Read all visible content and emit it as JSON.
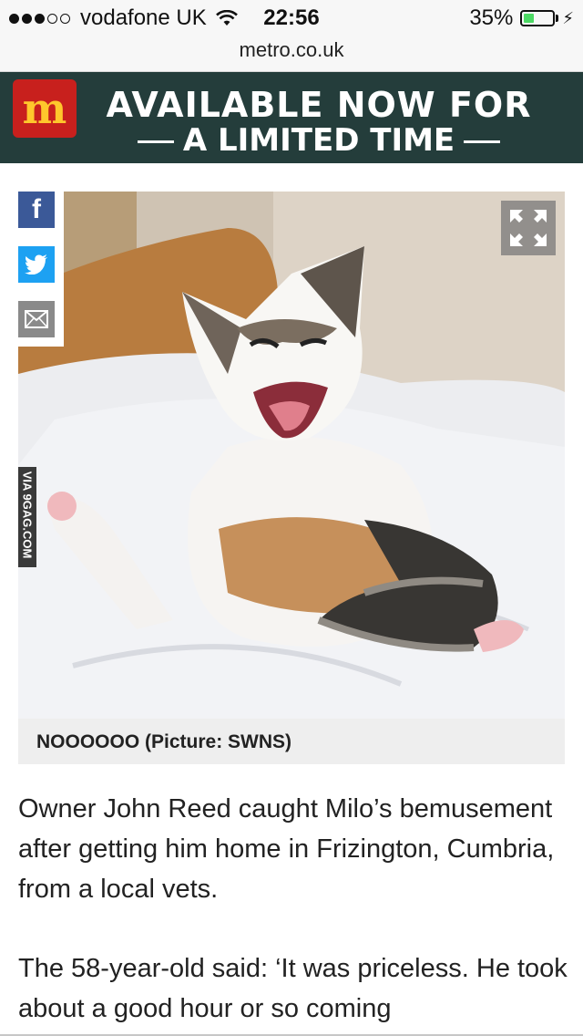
{
  "status_bar": {
    "carrier": "vodafone UK",
    "time": "22:56",
    "battery_percent": "35%",
    "battery_level": 0.35,
    "url": "metro.co.uk"
  },
  "ad": {
    "logo_text": "m",
    "line1": "AVAILABLE NOW FOR",
    "line2": "A LIMITED TIME"
  },
  "share": {
    "facebook": "f"
  },
  "image": {
    "watermark": "VIA 9GAG.COM",
    "caption": "NOOOOOO (Picture: SWNS)"
  },
  "article": {
    "paragraph1": "Owner John Reed caught Milo’s bemusement after getting him home in Frizington, Cumbria, from a local vets.",
    "paragraph2": "The 58-year-old said: ‘It was priceless. He took about a good hour or so coming"
  },
  "colors": {
    "ad_background": "#243d3b",
    "facebook": "#3b5998",
    "twitter": "#1da1f2",
    "battery": "#4cd964"
  }
}
